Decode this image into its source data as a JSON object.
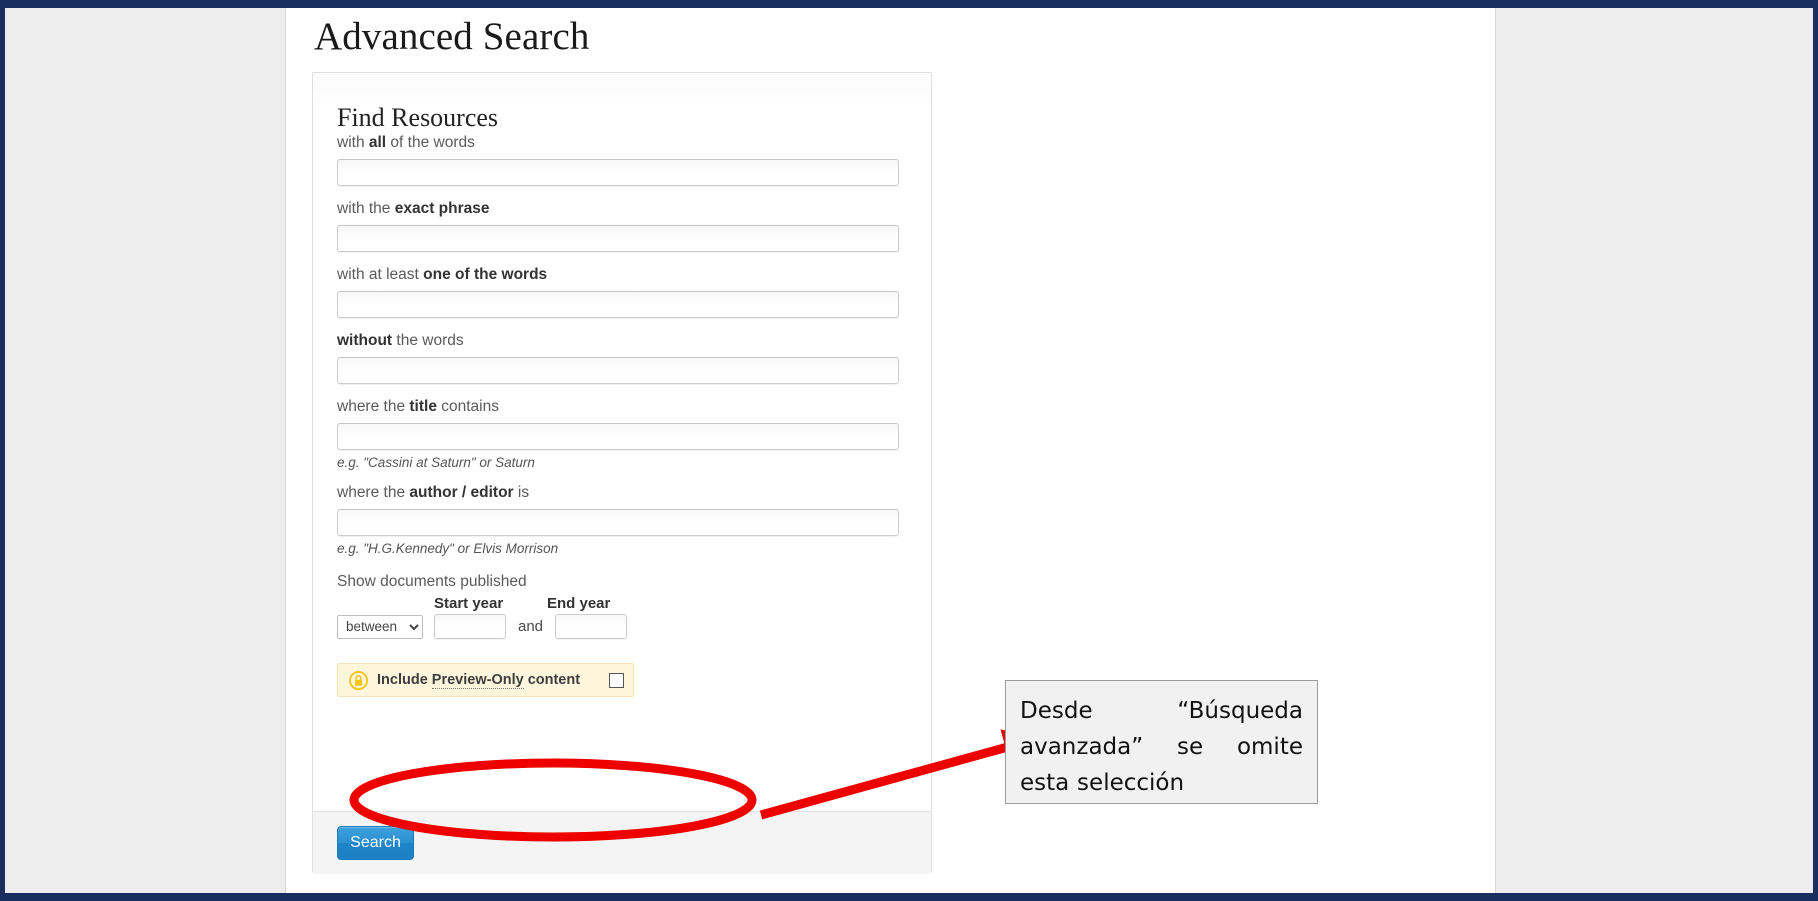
{
  "page": {
    "title": "Advanced Search",
    "panel_title": "Find Resources"
  },
  "form": {
    "fields": [
      {
        "label_prefix": "with ",
        "label_strong": "all",
        "label_suffix": " of the words",
        "value": "",
        "hint": ""
      },
      {
        "label_prefix": "with the ",
        "label_strong": "exact phrase",
        "label_suffix": "",
        "value": "",
        "hint": ""
      },
      {
        "label_prefix": "with at least ",
        "label_strong": "one of the words",
        "label_suffix": "",
        "value": "",
        "hint": ""
      },
      {
        "label_prefix": "",
        "label_strong": "without",
        "label_suffix": " the words",
        "value": "",
        "hint": ""
      },
      {
        "label_prefix": "where the ",
        "label_strong": "title",
        "label_suffix": " contains",
        "value": "",
        "hint": "e.g. \"Cassini at Saturn\" or Saturn"
      },
      {
        "label_prefix": "where the ",
        "label_strong": "author / editor",
        "label_suffix": " is",
        "value": "",
        "hint": "e.g. \"H.G.Kennedy\" or Elvis Morrison"
      }
    ],
    "date_section": {
      "label": "Show documents published",
      "start_year_header": "Start year",
      "end_year_header": "End year",
      "range_selected": "between",
      "range_options": [
        "between"
      ],
      "start_year_value": "",
      "end_year_value": "",
      "conjunction": "and"
    },
    "preview_only": {
      "icon": "lock-icon",
      "label_prefix": "Include ",
      "label_dotted": "Preview-Only",
      "label_suffix": " content",
      "checked": false
    },
    "submit_label": "Search"
  },
  "annotation": {
    "callout_text": "Desde “Búsqueda avanzada” se omite esta selección",
    "ellipse_color": "#ee0000",
    "arrow_color": "#ee0000",
    "callout_bg": "#f1f1f1",
    "callout_border": "#9a9a9a"
  },
  "colors": {
    "frame": "#1b2f5e",
    "page_background": "#ededed",
    "content_background": "#ffffff",
    "highlight_row_bg": "#fdf6dd",
    "lock_yellow": "#f5c518",
    "button_blue": "#2a8fd0"
  }
}
